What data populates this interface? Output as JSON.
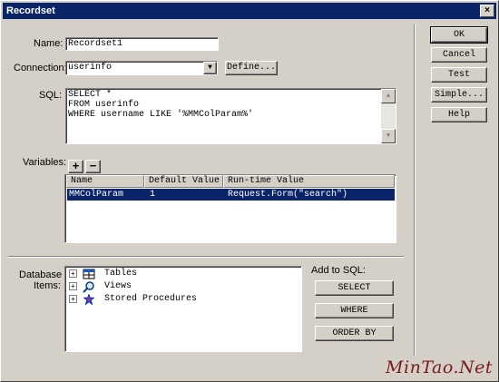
{
  "window": {
    "title": "Recordset",
    "close_glyph": "×"
  },
  "fields": {
    "name_label": "Name:",
    "name_value": "Recordset1",
    "connection_label": "Connection:",
    "connection_value": "userinfo",
    "define_button": "Define...",
    "sql_label": "SQL:",
    "sql_lines": [
      "SELECT *",
      "FROM userinfo",
      "WHERE username LIKE '%MMColParam%'"
    ]
  },
  "variables": {
    "label": "Variables:",
    "add_glyph": "+",
    "remove_glyph": "−",
    "columns": [
      "Name",
      "Default Value",
      "Run-time Value"
    ],
    "rows": [
      {
        "name": "MMColParam",
        "default": "1",
        "runtime": "Request.Form(\"search\")"
      }
    ]
  },
  "database": {
    "label_line1": "Database",
    "label_line2": "Items:",
    "items": [
      {
        "label": "Tables",
        "icon": "table-icon"
      },
      {
        "label": "Views",
        "icon": "view-icon"
      },
      {
        "label": "Stored Procedures",
        "icon": "stored-procedure-icon"
      }
    ],
    "expander_glyph": "+"
  },
  "add_to_sql": {
    "label": "Add to SQL:",
    "select_button": "SELECT",
    "where_button": "WHERE",
    "orderby_button": "ORDER BY"
  },
  "side_buttons": {
    "ok": "OK",
    "cancel": "Cancel",
    "test": "Test",
    "simple": "Simple...",
    "help": "Help"
  },
  "watermark": "MinTao.Net",
  "colors": {
    "titlebar": "#0a246a",
    "face": "#d4d0c8",
    "selection": "#0a246a",
    "watermark": "#7a1a1a"
  }
}
